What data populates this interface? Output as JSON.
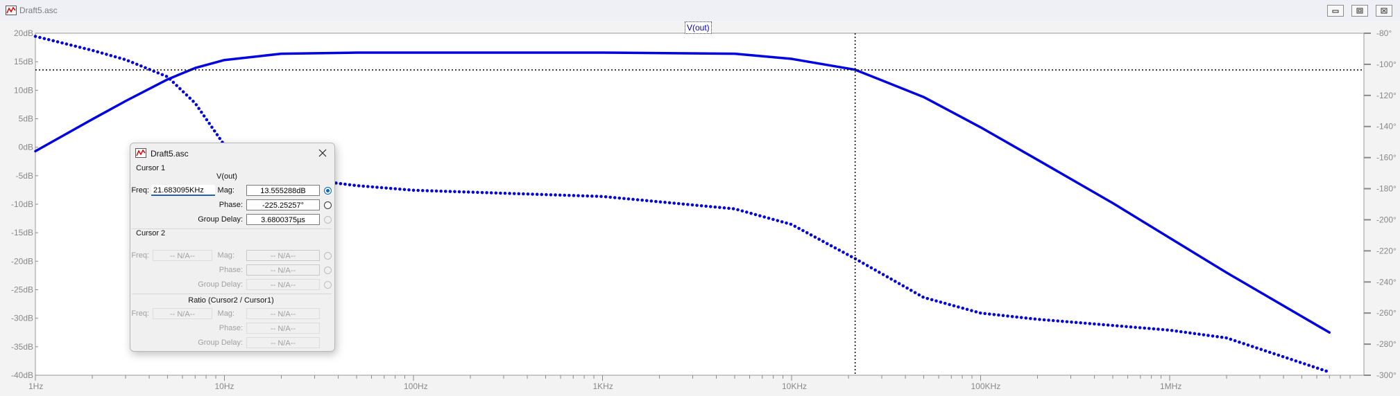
{
  "window": {
    "title": "Draft5.asc",
    "buttons": [
      "minimize-icon",
      "restore-icon",
      "close-icon"
    ]
  },
  "plot": {
    "trace_label": "V(out)",
    "trace_color": "#0000e0",
    "left_ticks": [
      "20dB",
      "15dB",
      "10dB",
      "5dB",
      "0dB",
      "-5dB",
      "-10dB",
      "-15dB",
      "-20dB",
      "-25dB",
      "-30dB",
      "-35dB",
      "-40dB"
    ],
    "right_ticks": [
      "-80°",
      "-100°",
      "-120°",
      "-140°",
      "-160°",
      "-180°",
      "-200°",
      "-220°",
      "-240°",
      "-260°",
      "-280°",
      "-300°"
    ],
    "x_ticks": [
      "1Hz",
      "10Hz",
      "100Hz",
      "1KHz",
      "10KHz",
      "100KHz",
      "1MHz"
    ]
  },
  "chart_data": {
    "type": "line",
    "title": "V(out)",
    "x_scale": "log",
    "xlim": [
      "1Hz",
      "7MHz"
    ],
    "ylim_left": [
      -40,
      20
    ],
    "ylim_right": [
      -300,
      -80
    ],
    "grid": false,
    "series": [
      {
        "name": "V(out)",
        "style": "solid",
        "axis": "left",
        "x": [
          1,
          2,
          3,
          5,
          7,
          10,
          20,
          50,
          100,
          1000,
          5000,
          10000,
          21683,
          50000,
          100000,
          200000,
          500000,
          1000000,
          2000000,
          7000000
        ],
        "values": [
          -0.7,
          4.9,
          8.1,
          11.9,
          13.9,
          15.3,
          16.4,
          16.6,
          16.6,
          16.6,
          16.4,
          15.5,
          13.6,
          8.8,
          3.5,
          -2.2,
          -9.8,
          -15.9,
          -22.0,
          -32.5
        ]
      },
      {
        "name": "Phase",
        "style": "dotted",
        "axis": "right",
        "x": [
          1,
          2,
          3,
          5,
          7,
          10,
          20,
          50,
          100,
          1000,
          5000,
          10000,
          21683,
          50000,
          100000,
          200000,
          500000,
          1000000,
          2000000,
          7000000
        ],
        "values": [
          -82,
          -91,
          -97,
          -108,
          -125,
          -152,
          -172,
          -178,
          -181,
          -185,
          -193,
          -203,
          -225,
          -250,
          -260,
          -264,
          -268,
          -271,
          -276,
          -298
        ]
      }
    ],
    "cursor": {
      "x": 21683,
      "y": 13.56
    }
  },
  "dialog": {
    "title": "Draft5.asc",
    "close_icon": "close-icon",
    "cursor1": {
      "heading": "Cursor 1",
      "trace": "V(out)",
      "freq_label": "Freq:",
      "freq_value": "21.683095KHz",
      "mag_label": "Mag:",
      "mag_value": "13.555288dB",
      "phase_label": "Phase:",
      "phase_value": "-225.25257°",
      "gd_label": "Group Delay:",
      "gd_value": "3.6800375µs"
    },
    "cursor2": {
      "heading": "Cursor 2",
      "freq_label": "Freq:",
      "freq_value": "-- N/A--",
      "mag_label": "Mag:",
      "mag_value": "-- N/A--",
      "phase_label": "Phase:",
      "phase_value": "-- N/A--",
      "gd_label": "Group Delay:",
      "gd_value": "-- N/A--"
    },
    "ratio": {
      "heading": "Ratio (Cursor2 / Cursor1)",
      "freq_label": "Freq:",
      "freq_value": "-- N/A--",
      "mag_label": "Mag:",
      "mag_value": "-- N/A--",
      "phase_label": "Phase:",
      "phase_value": "-- N/A--",
      "gd_label": "Group Delay:",
      "gd_value": "-- N/A--"
    }
  }
}
